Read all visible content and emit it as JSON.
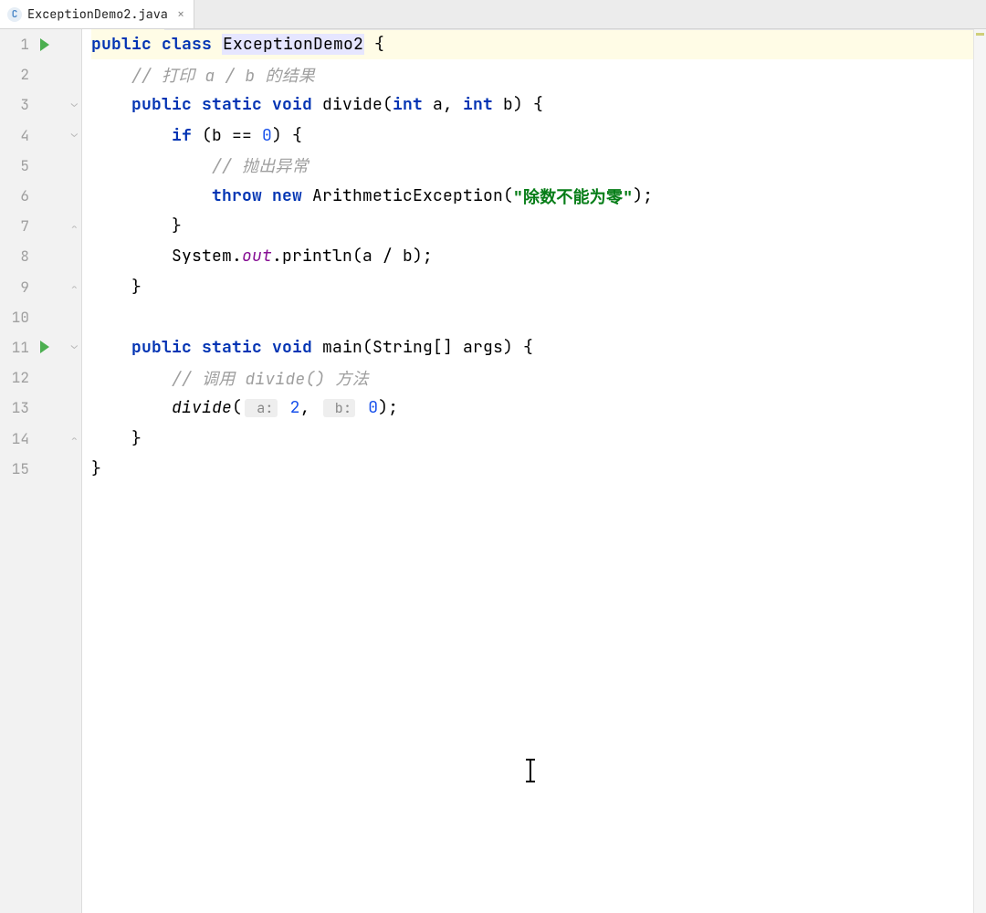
{
  "tab": {
    "filename": "ExceptionDemo2.java",
    "icon_letter": "C"
  },
  "gutter": {
    "run_markers": [
      1,
      11
    ],
    "fold_markers": {
      "3": "open-top",
      "4": "open-top",
      "7": "close",
      "9": "close",
      "11": "open-top",
      "14": "close"
    }
  },
  "code": {
    "lines": [
      {
        "n": 1,
        "hl": true,
        "tokens": [
          {
            "t": "public",
            "c": "kw"
          },
          {
            "t": " "
          },
          {
            "t": "class",
            "c": "kw"
          },
          {
            "t": " "
          },
          {
            "t": "ExceptionDemo2",
            "c": "cls-hl"
          },
          {
            "t": " {"
          }
        ]
      },
      {
        "n": 2,
        "tokens": [
          {
            "t": "    "
          },
          {
            "t": "// 打印 a / b 的结果",
            "c": "comment"
          }
        ]
      },
      {
        "n": 3,
        "tokens": [
          {
            "t": "    "
          },
          {
            "t": "public",
            "c": "kw"
          },
          {
            "t": " "
          },
          {
            "t": "static",
            "c": "kw"
          },
          {
            "t": " "
          },
          {
            "t": "void",
            "c": "kw"
          },
          {
            "t": " divide("
          },
          {
            "t": "int",
            "c": "kw"
          },
          {
            "t": " a, "
          },
          {
            "t": "int",
            "c": "kw"
          },
          {
            "t": " b) {"
          }
        ]
      },
      {
        "n": 4,
        "tokens": [
          {
            "t": "        "
          },
          {
            "t": "if",
            "c": "kw"
          },
          {
            "t": " (b == "
          },
          {
            "t": "0",
            "c": "num"
          },
          {
            "t": ") {"
          }
        ]
      },
      {
        "n": 5,
        "tokens": [
          {
            "t": "            "
          },
          {
            "t": "// 抛出异常",
            "c": "comment"
          }
        ]
      },
      {
        "n": 6,
        "tokens": [
          {
            "t": "            "
          },
          {
            "t": "throw",
            "c": "kw"
          },
          {
            "t": " "
          },
          {
            "t": "new",
            "c": "kw"
          },
          {
            "t": " ArithmeticException("
          },
          {
            "t": "\"除数不能为零\"",
            "c": "str"
          },
          {
            "t": ");"
          }
        ]
      },
      {
        "n": 7,
        "tokens": [
          {
            "t": "        }"
          }
        ]
      },
      {
        "n": 8,
        "tokens": [
          {
            "t": "        System."
          },
          {
            "t": "out",
            "c": "field"
          },
          {
            "t": ".println(a / b);"
          }
        ]
      },
      {
        "n": 9,
        "tokens": [
          {
            "t": "    }"
          }
        ]
      },
      {
        "n": 10,
        "tokens": [
          {
            "t": ""
          }
        ]
      },
      {
        "n": 11,
        "tokens": [
          {
            "t": "    "
          },
          {
            "t": "public",
            "c": "kw"
          },
          {
            "t": " "
          },
          {
            "t": "static",
            "c": "kw"
          },
          {
            "t": " "
          },
          {
            "t": "void",
            "c": "kw"
          },
          {
            "t": " main(String[] args) {"
          }
        ]
      },
      {
        "n": 12,
        "tokens": [
          {
            "t": "        "
          },
          {
            "t": "// 调用 divide() 方法",
            "c": "comment"
          }
        ]
      },
      {
        "n": 13,
        "tokens": [
          {
            "t": "        "
          },
          {
            "t": "divide",
            "c": "fn"
          },
          {
            "t": "("
          },
          {
            "t": " a:",
            "c": "param-hint"
          },
          {
            "t": " "
          },
          {
            "t": "2",
            "c": "num"
          },
          {
            "t": ", "
          },
          {
            "t": " b:",
            "c": "param-hint"
          },
          {
            "t": " "
          },
          {
            "t": "0",
            "c": "num"
          },
          {
            "t": ");"
          }
        ]
      },
      {
        "n": 14,
        "tokens": [
          {
            "t": "    }"
          }
        ]
      },
      {
        "n": 15,
        "tokens": [
          {
            "t": "}"
          }
        ]
      }
    ]
  }
}
